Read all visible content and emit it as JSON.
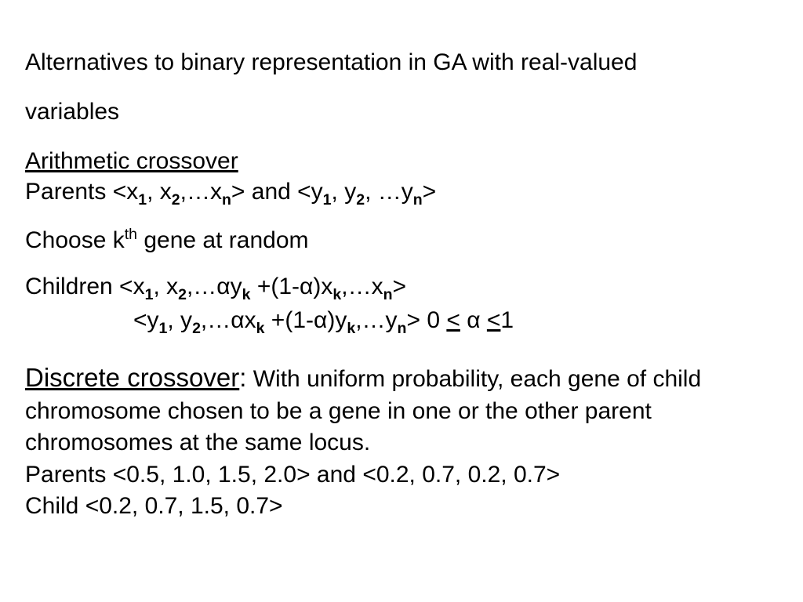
{
  "title_l1": " Alternatives to binary representation in GA with real-valued",
  "title_l2": "variables",
  "arith_head": "Arithmetic crossover",
  "parents_label": "Parents <x",
  "parents_middle": "> and <y",
  "parents_close": ">",
  "choose_label": "Choose k",
  "choose_tail": " gene at random",
  "children_label": "Children <x",
  "child1_mid": "y",
  "child1_mid2": " +(1-",
  "child1_mid3": ")x",
  "child2_mid": "x",
  "child2_mid3": ")y",
  "alpha_cond_pre": ">  0 ",
  "alpha_cond_post": "1",
  "le": "<",
  "disc_head": "Discrete crossover",
  "disc_colon": ":",
  "disc_desc": "  With uniform probability, each gene of child chromosome chosen to be a gene in one or the other parent chromosomes at the same locus.",
  "disc_parents": "Parents <0.5, 1.0, 1.5, 2.0> and <0.2, 0.7, 0.2, 0.7>",
  "disc_child": "Child  <0.2, 0.7, 1.5, 0.7>"
}
